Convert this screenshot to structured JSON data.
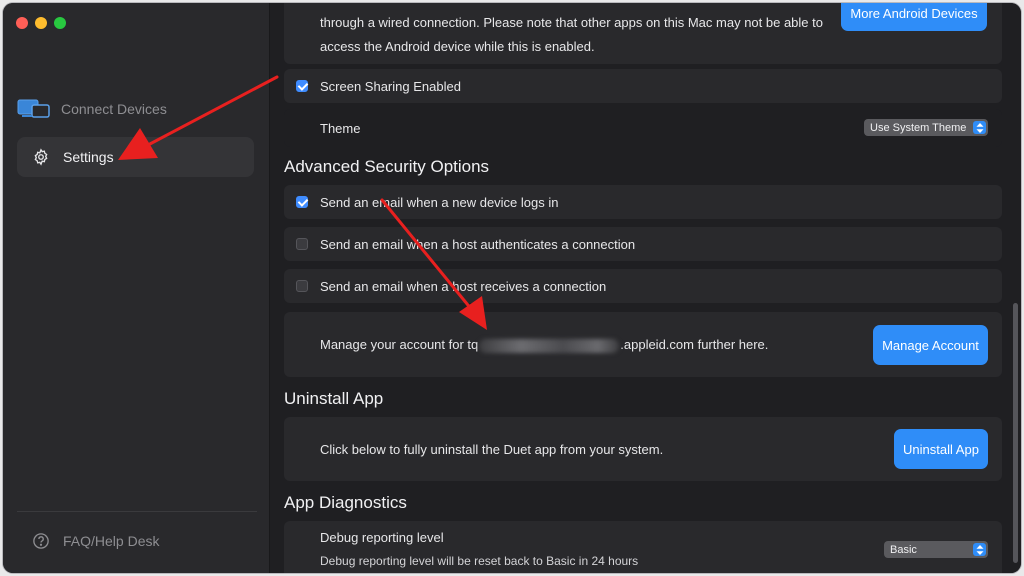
{
  "sidebar": {
    "items": [
      {
        "label": "Connect Devices"
      },
      {
        "label": "Settings"
      }
    ],
    "footer": {
      "label": "FAQ/Help Desk"
    }
  },
  "main": {
    "wired": {
      "line1": "through a wired connection.  Please note that other apps on this Mac may not be able to",
      "line2": "access the Android device while this is enabled.",
      "button": "More Android Devices"
    },
    "screen_sharing": {
      "label": "Screen Sharing Enabled",
      "checked": true
    },
    "theme": {
      "label": "Theme",
      "value": "Use System Theme"
    },
    "security": {
      "heading": "Advanced Security Options",
      "options": [
        {
          "label": "Send an email when a new device logs in",
          "checked": true
        },
        {
          "label": "Send an email when a host authenticates a connection",
          "checked": false
        },
        {
          "label": "Send an email when a host receives a connection",
          "checked": false
        }
      ],
      "account_prefix": "Manage your account for tq",
      "account_suffix": ".appleid.com further here.",
      "manage_button": "Manage Account"
    },
    "uninstall": {
      "heading": "Uninstall App",
      "text": "Click below to fully uninstall the Duet app from your system.",
      "button": "Uninstall App"
    },
    "diagnostics": {
      "heading": "App Diagnostics",
      "label": "Debug reporting level",
      "note": "Debug reporting level will be reset back to Basic in 24 hours",
      "value": "Basic"
    }
  },
  "colors": {
    "accent": "#2f8df8",
    "annotation_arrow": "#e8201f"
  }
}
